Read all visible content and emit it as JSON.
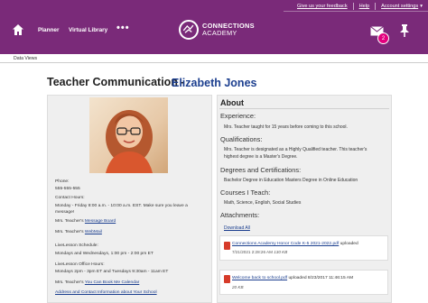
{
  "header": {
    "utility_links": [
      "Give us your feedback",
      "Help",
      "Account settings"
    ],
    "nav": [
      "Planner",
      "Virtual Library"
    ],
    "more": "•••",
    "logo_line1": "CONNECTIONS",
    "logo_line2": "ACADEMY",
    "mail_badge": "2",
    "brand_color": "#7a2a79"
  },
  "breadcrumb": "Data Views",
  "page": {
    "title": "Teacher Communication -",
    "teacher_name": "Elizabeth Jones"
  },
  "left": {
    "phone_label": "Phone:",
    "phone": "555-555-555",
    "contact_label": "Contact Hours:",
    "contact_hours_1": "Monday - Friday 8:00 a.m. - 10:00 a.m. EST. Make sure you leave a",
    "contact_hours_2": "message!",
    "message_board_prefix": "Mrs. Teacher's",
    "message_board_link": "Message Board",
    "webmail_prefix": "Mrs. Teacher's",
    "webmail_link": "WebMail",
    "livelesson_label": "LiveLesson Schedule:",
    "livelesson_schedule": "Mondays and Wednesdays, 1:00 pm - 2:00 pm ET",
    "office_label": "LiveLesson Office Hours:",
    "office_hours": "Mondays 2pm - 3pm ET and Tuesdays 9:30am - 11am ET",
    "booking_prefix": "Mrs. Teacher's",
    "booking_link": "You Can Book Me Calendar",
    "address_link": "Address and Contact Information about Your School"
  },
  "about": {
    "title": "About",
    "experience_h": "Experience:",
    "experience_t": "Mrs. Teacher taught for 15 years before coming to this school.",
    "qual_h": "Qualifications:",
    "qual_t1": "Mrs. Teacher is designated as a Highly Qualified teacher. This teacher's",
    "qual_t2": "highest degree is a Master's Degree.",
    "degrees_h": "Degrees and Certifications:",
    "degrees_t": "Bachelor Degree in Education Masters Degree in Online Education",
    "courses_h": "Courses I Teach:",
    "courses_t": "Math, Science, English, Social Studies",
    "attach_h": "Attachments:",
    "download_all": "Download All",
    "attachments": [
      {
        "name": "Connections Academy Honor Code K-5 2021-2022.pdf",
        "action": "uploaded",
        "date": "7/21/2021 2:28:26 AM",
        "size": "130 KB"
      },
      {
        "name": "Welcome back to school.pdf",
        "action": "uploaded 8/23/2017 11:46:15 AM",
        "date": "",
        "size": "20 KB"
      }
    ]
  }
}
